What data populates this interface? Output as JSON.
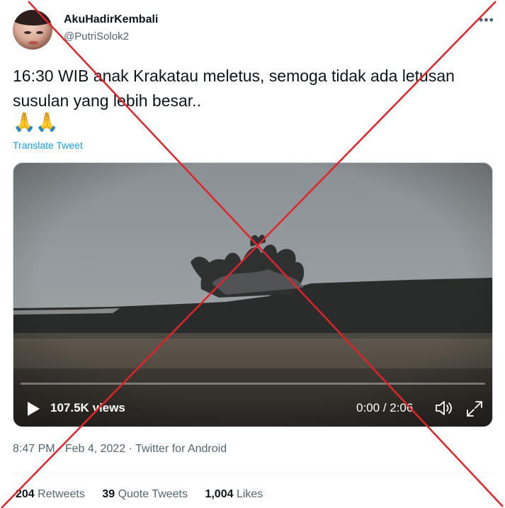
{
  "author": {
    "display_name": "AkuHadirKembali",
    "handle": "@PutriSolok2"
  },
  "tweet": {
    "text": "16:30 WIB anak Krakatau meletus, semoga tidak ada letusan susulan yang lebih besar..",
    "emojis": "🙏🙏",
    "translate_label": "Translate Tweet"
  },
  "video": {
    "views_count": "107.5K",
    "views_label": "views",
    "time": "0:00 / 2:06",
    "progress": 0
  },
  "meta": {
    "time": "8:47 PM",
    "date": "Feb 4, 2022",
    "source": "Twitter for Android",
    "separator": " · "
  },
  "stats": {
    "retweets_count": "204",
    "retweets_label": "Retweets",
    "quotes_count": "39",
    "quotes_label": "Quote Tweets",
    "likes_count": "1,004",
    "likes_label": "Likes"
  },
  "overlay": {
    "cross_color": "#e0242b"
  },
  "colors": {
    "link": "#1d9bf0",
    "secondary_text": "#536471"
  }
}
